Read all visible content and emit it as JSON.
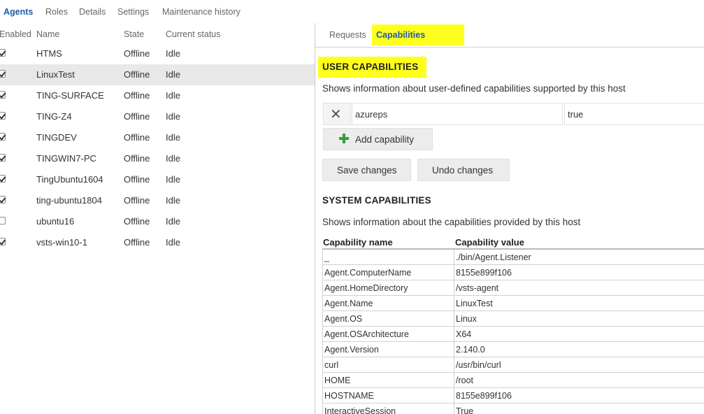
{
  "topnav": {
    "tabs": [
      "Agents",
      "Roles",
      "Details",
      "Settings",
      "Maintenance history"
    ]
  },
  "agents_table": {
    "headers": {
      "enabled": "Enabled",
      "name": "Name",
      "state": "State",
      "status": "Current status"
    },
    "rows": [
      {
        "enabled": true,
        "name": "HTMS",
        "state": "Offline",
        "status": "Idle",
        "selected": false
      },
      {
        "enabled": true,
        "name": "LinuxTest",
        "state": "Offline",
        "status": "Idle",
        "selected": true
      },
      {
        "enabled": true,
        "name": "TING-SURFACE",
        "state": "Offline",
        "status": "Idle",
        "selected": false
      },
      {
        "enabled": true,
        "name": "TING-Z4",
        "state": "Offline",
        "status": "Idle",
        "selected": false
      },
      {
        "enabled": true,
        "name": "TINGDEV",
        "state": "Offline",
        "status": "Idle",
        "selected": false
      },
      {
        "enabled": true,
        "name": "TINGWIN7-PC",
        "state": "Offline",
        "status": "Idle",
        "selected": false
      },
      {
        "enabled": true,
        "name": "TingUbuntu1604",
        "state": "Offline",
        "status": "Idle",
        "selected": false
      },
      {
        "enabled": true,
        "name": "ting-ubuntu1804",
        "state": "Offline",
        "status": "Idle",
        "selected": false
      },
      {
        "enabled": false,
        "name": "ubuntu16",
        "state": "Offline",
        "status": "Idle",
        "selected": false
      },
      {
        "enabled": true,
        "name": "vsts-win10-1",
        "state": "Offline",
        "status": "Idle",
        "selected": false
      }
    ]
  },
  "detail": {
    "tabs": {
      "requests": "Requests",
      "capabilities": "Capabilities"
    },
    "user_caps": {
      "title": "USER CAPABILITIES",
      "description": "Shows information about user-defined capabilities supported by this host",
      "entry_key": "azureps",
      "entry_value": "true",
      "add_label": "Add capability",
      "save_label": "Save changes",
      "undo_label": "Undo changes"
    },
    "system_caps": {
      "title": "SYSTEM CAPABILITIES",
      "description": "Shows information about the capabilities provided by this host",
      "col_name": "Capability name",
      "col_value": "Capability value",
      "rows": [
        {
          "name": "_",
          "value": "./bin/Agent.Listener"
        },
        {
          "name": "Agent.ComputerName",
          "value": "8155e899f106"
        },
        {
          "name": "Agent.HomeDirectory",
          "value": "/vsts-agent"
        },
        {
          "name": "Agent.Name",
          "value": "LinuxTest"
        },
        {
          "name": "Agent.OS",
          "value": "Linux"
        },
        {
          "name": "Agent.OSArchitecture",
          "value": "X64"
        },
        {
          "name": "Agent.Version",
          "value": "2.140.0"
        },
        {
          "name": "curl",
          "value": "/usr/bin/curl"
        },
        {
          "name": "HOME",
          "value": "/root"
        },
        {
          "name": "HOSTNAME",
          "value": "8155e899f106"
        },
        {
          "name": "InteractiveSession",
          "value": "True"
        }
      ]
    }
  },
  "colors": {
    "accent": "#1e5aa8",
    "highlight": "#ffff1e",
    "selected_row": "#e8e8e8",
    "add_icon": "#3a9a3a"
  },
  "icons": {
    "delete": "close-icon",
    "add": "plus-icon",
    "enabled": "checkbox-icon"
  }
}
